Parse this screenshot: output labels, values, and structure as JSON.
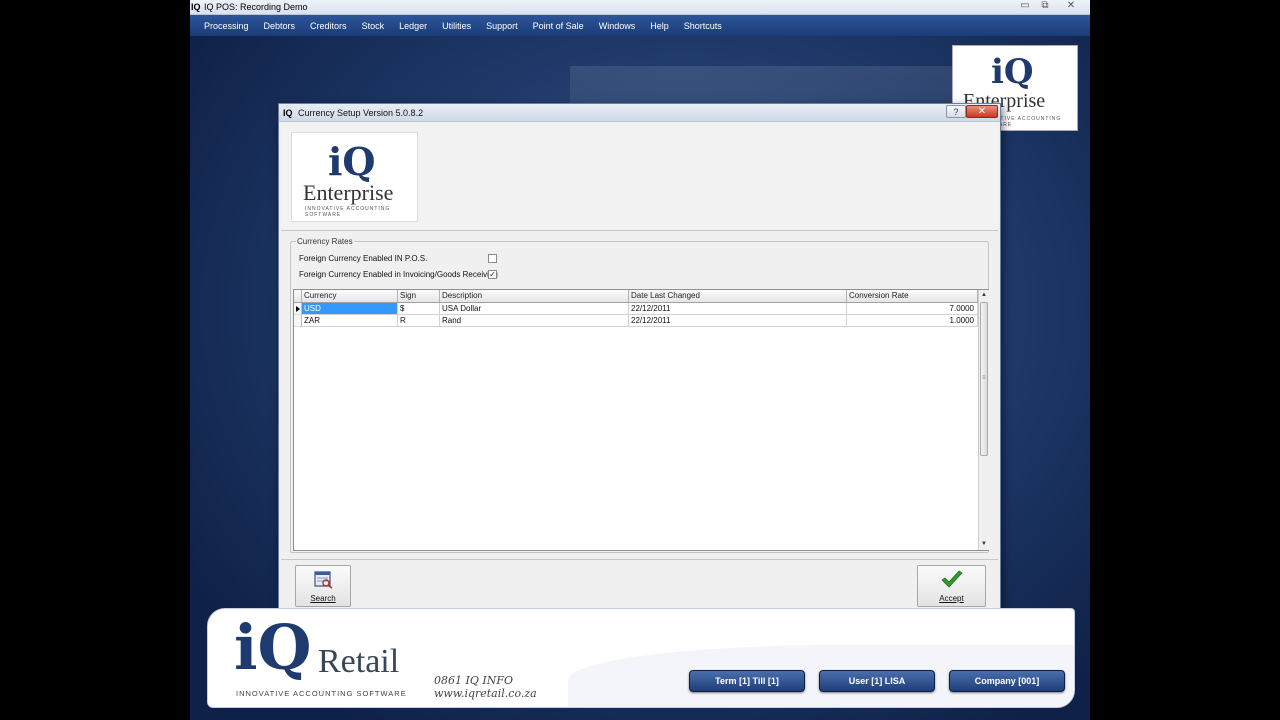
{
  "window": {
    "title": "IQ POS: Recording Demo",
    "app_icon": "IQ",
    "minimize": "▭",
    "restore": "⧉",
    "close": "✕"
  },
  "menu": [
    "Processing",
    "Debtors",
    "Creditors",
    "Stock",
    "Ledger",
    "Utilities",
    "Support",
    "Point of Sale",
    "Windows",
    "Help",
    "Shortcuts"
  ],
  "logo": {
    "iq": "iQ",
    "enterprise": "Enterprise",
    "tagline": "INNOVATIVE ACCOUNTING SOFTWARE"
  },
  "dialog": {
    "title": "Currency Setup Version 5.0.8.2",
    "icon": "IQ",
    "help": "?",
    "close": "✕",
    "group_title": "Currency Rates",
    "options": [
      {
        "label": "Foreign Currency Enabled IN P.O.S.",
        "checked": false
      },
      {
        "label": "Foreign Currency Enabled in Invoicing/Goods Receiving",
        "checked": true
      }
    ],
    "columns": [
      "Currency",
      "Sign",
      "Description",
      "Date Last Changed",
      "Conversion Rate"
    ],
    "rows": [
      {
        "currency": "USD",
        "sign": "$",
        "description": "USA Dollar",
        "date": "22/12/2011",
        "rate": "7.0000"
      },
      {
        "currency": "ZAR",
        "sign": "R",
        "description": "Rand",
        "date": "22/12/2011",
        "rate": "1.0000"
      }
    ],
    "search_label": "Search",
    "accept_label": "Accept",
    "check_mark": "✓"
  },
  "footer": {
    "brand_iq": "iQ",
    "brand_retail": "Retail",
    "tagline": "INNOVATIVE ACCOUNTING SOFTWARE",
    "phone": "0861 IQ INFO",
    "web": "www.iqretail.co.za",
    "term": "Term [1] Till [1]",
    "user": "User [1] LISA",
    "company": "Company [001]"
  },
  "colors": {
    "menu_bg": "#1f4080",
    "selection": "#3399ff",
    "accept_green": "#2e9d2e",
    "status_button": "#2a4c8c"
  }
}
